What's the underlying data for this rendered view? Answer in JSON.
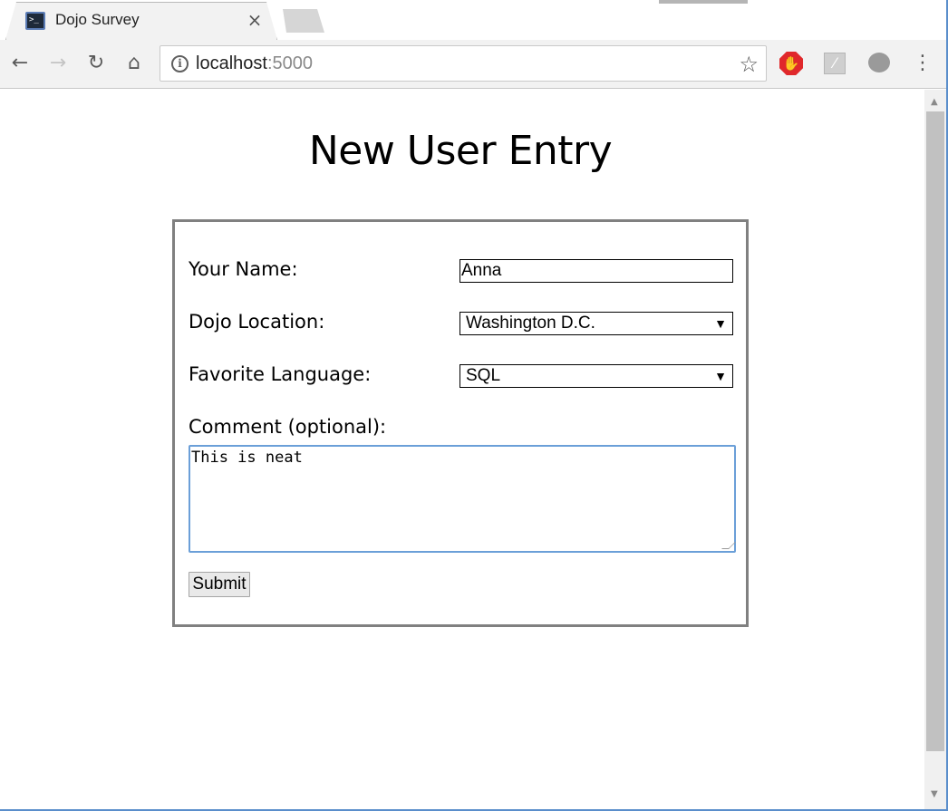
{
  "browser": {
    "tab": {
      "title": "Dojo Survey",
      "close_glyph": "×"
    },
    "nav": {
      "back_glyph": "←",
      "forward_glyph": "→",
      "reload_glyph": "↻",
      "home_glyph": "⌂"
    },
    "address": {
      "host": "localhost",
      "port": ":5000",
      "info_glyph": "i"
    },
    "bookmark_glyph": "☆",
    "menu_glyph": "⋮"
  },
  "page": {
    "title": "New User Entry",
    "form": {
      "name_label": "Your Name:",
      "name_value": "Anna",
      "location_label": "Dojo Location:",
      "location_value": "Washington D.C.",
      "language_label": "Favorite Language:",
      "language_value": "SQL",
      "comment_label": "Comment (optional):",
      "comment_value": "This is neat",
      "submit_label": "Submit",
      "dropdown_arrow": "▼"
    }
  },
  "colors": {
    "form_border": "#808080",
    "textarea_focus": "#6b9fd8",
    "adblock_red": "#e0282b"
  }
}
